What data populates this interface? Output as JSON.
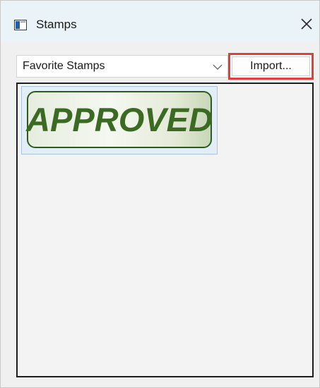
{
  "window": {
    "title": "Stamps",
    "title_icon": "window-icon",
    "close_icon": "close-icon"
  },
  "toolbar": {
    "dropdown_value": "Favorite Stamps",
    "dropdown_icon": "chevron-down-icon",
    "import_label": "Import..."
  },
  "stamps": {
    "items": [
      {
        "label": "APPROVED",
        "color": "#3b6a22"
      }
    ]
  },
  "colors": {
    "title_bar": "#eaf3f8",
    "highlight_border": "#e53c3c",
    "stamp_text": "#3b6a22",
    "selection": "#e3edf6"
  }
}
